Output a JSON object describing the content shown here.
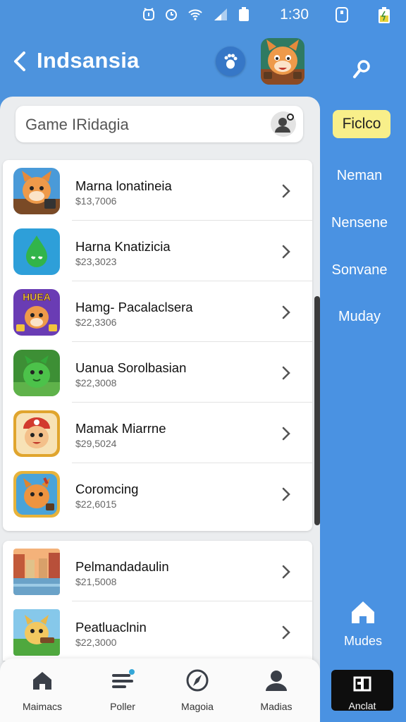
{
  "status_bar": {
    "time": "1:30"
  },
  "header": {
    "title": "Indsansia"
  },
  "search": {
    "text": "Game IRidagia"
  },
  "list1": [
    {
      "name": "Marna lonatineia",
      "price": "$13,7006"
    },
    {
      "name": "Harna Knatizicia",
      "price": "$23,3023"
    },
    {
      "name": "Hamg- Pacalaclsera",
      "price": "$22,3306",
      "badge": "HUEA"
    },
    {
      "name": "Uanua Sorolbasian",
      "price": "$22,3008"
    },
    {
      "name": "Mamak Miarrne",
      "price": "$29,5024"
    },
    {
      "name": "Coromcing",
      "price": "$22,6015"
    }
  ],
  "list2": [
    {
      "name": "Pelmandadaulin",
      "price": "$21,5008"
    },
    {
      "name": "Peatluaclnin",
      "price": "$22,3000"
    }
  ],
  "bottom_nav": [
    {
      "label": "Maimacs",
      "icon": "home-icon"
    },
    {
      "label": "Poller",
      "icon": "menu-lines-icon"
    },
    {
      "label": "Magoia",
      "icon": "compass-icon"
    },
    {
      "label": "Madias",
      "icon": "person-icon"
    }
  ],
  "side_panel": {
    "active_item": "Ficlco",
    "items": [
      "Neman",
      "Nensene",
      "Sonvane",
      "Muday"
    ],
    "home_label": "Mudes",
    "action_label": "Anclat"
  },
  "colors": {
    "primary_blue": "#4d93dd",
    "highlight_yellow": "#f8ef8a",
    "background_gray": "#ebedef"
  }
}
